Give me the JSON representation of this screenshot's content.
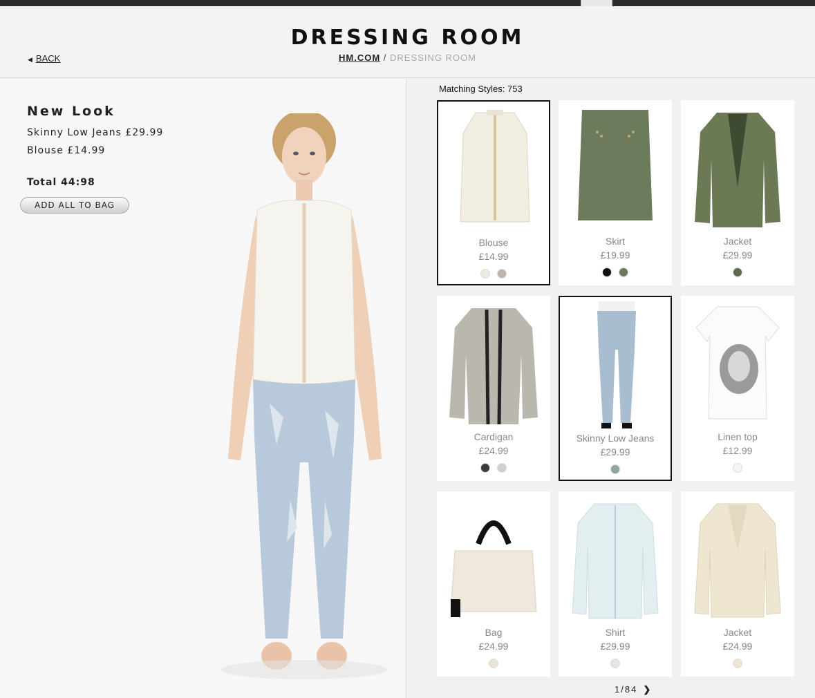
{
  "header": {
    "title": "DRESSING ROOM",
    "breadcrumb_home": "HM.COM",
    "breadcrumb_sep": "/",
    "breadcrumb_current": "DRESSING ROOM",
    "back_label": "BACK"
  },
  "look": {
    "title": "New Look",
    "items": [
      "Skinny Low Jeans £29.99",
      "Blouse £14.99"
    ],
    "total": "Total 44:98",
    "add_all_label": "ADD ALL TO BAG"
  },
  "matching": {
    "label": "Matching Styles: 753"
  },
  "products": [
    {
      "name": "Blouse",
      "price": "£14.99",
      "selected": true,
      "swatches": [
        "#efeae0",
        "#bdb5ab"
      ]
    },
    {
      "name": "Skirt",
      "price": "£19.99",
      "selected": false,
      "swatches": [
        "#111111",
        "#6b7a5c"
      ]
    },
    {
      "name": "Jacket",
      "price": "£29.99",
      "selected": false,
      "swatches": [
        "#5d6a4b"
      ]
    },
    {
      "name": "Cardigan",
      "price": "£24.99",
      "selected": false,
      "swatches": [
        "#3a3a3a",
        "#cfcfcf"
      ]
    },
    {
      "name": "Skinny Low Jeans",
      "price": "£29.99",
      "selected": true,
      "swatches": [
        "#8fa6a0"
      ]
    },
    {
      "name": "Linen top",
      "price": "£12.99",
      "selected": false,
      "swatches": [
        "#f4f4f4"
      ]
    },
    {
      "name": "Bag",
      "price": "£24.99",
      "selected": false,
      "swatches": [
        "#ebe3d8"
      ]
    },
    {
      "name": "Shirt",
      "price": "£29.99",
      "selected": false,
      "swatches": [
        "#e2e6e6"
      ]
    },
    {
      "name": "Jacket",
      "price": "£24.99",
      "selected": false,
      "swatches": [
        "#ede5d2"
      ]
    }
  ],
  "pager": {
    "text": "1/84"
  },
  "icons": {
    "back": "chevron-left-icon",
    "slide": "chevron-right-icon",
    "pager_next": "chevron-right-icon"
  }
}
